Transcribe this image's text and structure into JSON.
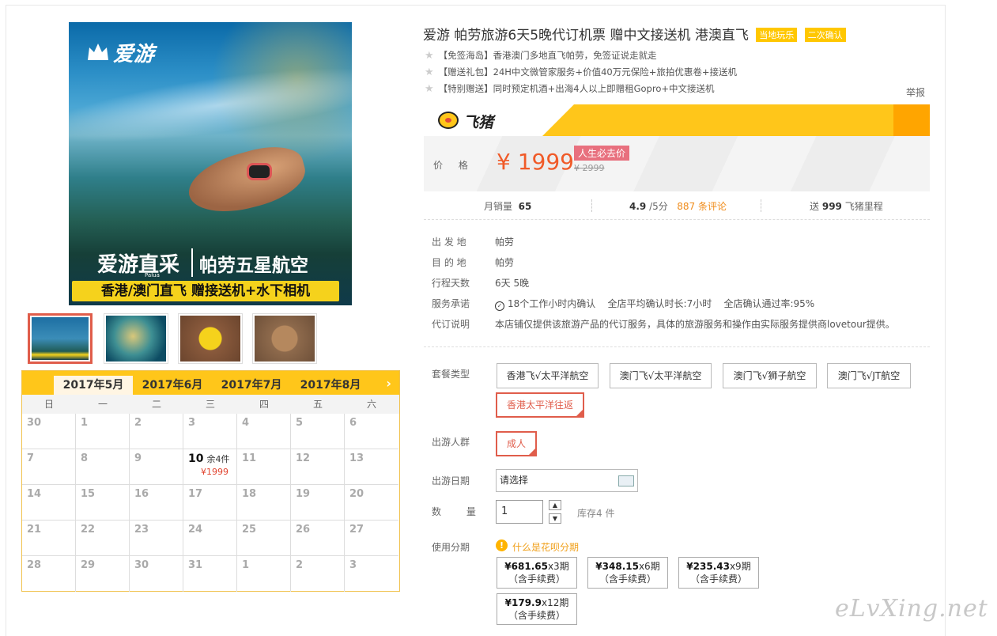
{
  "product": {
    "title": "爱游 帕劳旅游6天5晚代订机票 赠中文接送机 港澳直飞",
    "tags": [
      "当地玩乐",
      "二次确认"
    ],
    "features": [
      "【免签海岛】香港澳门多地直飞帕劳，免签证说走就走",
      "【赠送礼包】24H中文微管家服务+价值40万元保险+旅拍优惠卷+接送机",
      "【特别赠送】同时预定机酒+出海4人以上即赠租Gopro+中文接送机"
    ],
    "report_label": "举报"
  },
  "main_image": {
    "logo_text": "爱游",
    "banner_left": "爱游直采",
    "banner_right": "帕劳五星航空",
    "small_text": "Palua",
    "banner_bottom": "香港/澳门直飞 赠接送机+水下相机"
  },
  "platform": {
    "name": "飞猪"
  },
  "price": {
    "label": "价 格",
    "current": "¥ 1999",
    "tag": "人生必去价",
    "original": "¥ 2999"
  },
  "stats": {
    "sales_label": "月销量",
    "sales_value": "65",
    "rating_value": "4.9",
    "rating_suffix": "/5分",
    "reviews": "887 条评论",
    "miles_prefix": "送",
    "miles_value": "999",
    "miles_suffix": "飞猪里程"
  },
  "info": [
    {
      "key": "出 发 地",
      "value": "帕劳"
    },
    {
      "key": "目 的 地",
      "value": "帕劳"
    },
    {
      "key": "行程天数",
      "value": "6天 5晚"
    },
    {
      "key": "服务承诺",
      "value": "18个工作小时内确认    全店平均确认时长:7小时    全店确认通过率:95%"
    },
    {
      "key": "代订说明",
      "value": "本店铺仅提供该旅游产品的代订服务，具体的旅游服务和操作由实际服务提供商lovetour提供。"
    }
  ],
  "options": {
    "package_label": "套餐类型",
    "packages": [
      "香港飞√太平洋航空",
      "澳门飞√太平洋航空",
      "澳门飞√狮子航空",
      "澳门飞√JT航空",
      "香港太平洋往返"
    ],
    "selected_package": "香港太平洋往返",
    "crowd_label": "出游人群",
    "crowd": "成人",
    "date_label": "出游日期",
    "date_placeholder": "请选择",
    "qty_label": "数 量",
    "qty_value": "1",
    "stock": "库存4 件",
    "installment_label": "使用分期",
    "installment_link": "什么是花呗分期",
    "installments": [
      {
        "amount": "¥681.65",
        "period": "x3期",
        "fee": "（含手续费）"
      },
      {
        "amount": "¥348.15",
        "period": "x6期",
        "fee": "（含手续费）"
      },
      {
        "amount": "¥235.43",
        "period": "x9期",
        "fee": "（含手续费）"
      },
      {
        "amount": "¥179.9",
        "period": "x12期",
        "fee": "（含手续费）"
      }
    ]
  },
  "calendar": {
    "months": [
      "2017年5月",
      "2017年6月",
      "2017年7月",
      "2017年8月"
    ],
    "active_month": "2017年5月",
    "weekdays": [
      "日",
      "一",
      "二",
      "三",
      "四",
      "五",
      "六"
    ],
    "days": [
      "30",
      "1",
      "2",
      "3",
      "4",
      "5",
      "6",
      "7",
      "8",
      "9",
      "10",
      "11",
      "12",
      "13",
      "14",
      "15",
      "16",
      "17",
      "18",
      "19",
      "20",
      "21",
      "22",
      "23",
      "24",
      "25",
      "26",
      "27",
      "28",
      "29",
      "30",
      "31",
      "1",
      "2",
      "3"
    ],
    "available_day": "10",
    "available_left": "余4件",
    "available_price": "¥1999"
  },
  "watermark": "eLvXing.net"
}
